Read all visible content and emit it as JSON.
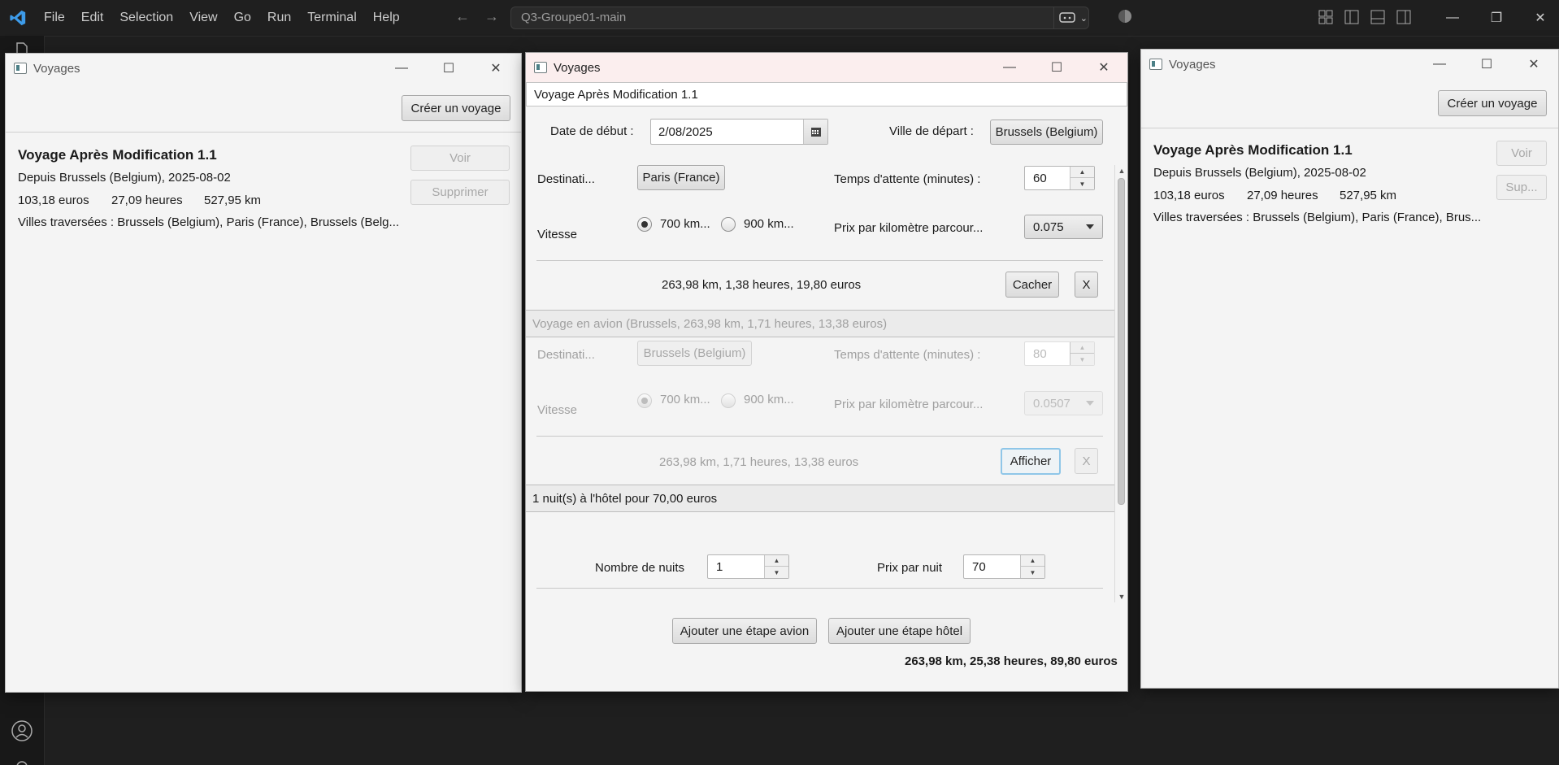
{
  "vscode": {
    "menu": [
      "File",
      "Edit",
      "Selection",
      "View",
      "Go",
      "Run",
      "Terminal",
      "Help"
    ],
    "search_text": "Q3-Groupe01-main"
  },
  "left_window": {
    "title": "Voyages",
    "create_button": "Créer un voyage",
    "voyage": {
      "name": "Voyage Après Modification 1.1",
      "origin": "Depuis Brussels (Belgium), 2025-08-02",
      "price": "103,18 euros",
      "hours": "27,09 heures",
      "km": "527,95 km",
      "cities": "Villes traversées : Brussels (Belgium), Paris (France), Brussels (Belg..."
    },
    "view_button": "Voir",
    "delete_button": "Supprimer"
  },
  "right_window": {
    "title": "Voyages",
    "create_button": "Créer un voyage",
    "voyage": {
      "name": "Voyage Après Modification 1.1",
      "origin": "Depuis Brussels (Belgium), 2025-08-02",
      "price": "103,18 euros",
      "hours": "27,09 heures",
      "km": "527,95 km",
      "cities": "Villes traversées : Brussels (Belgium), Paris (France), Brus..."
    },
    "view_button": "Voir",
    "delete_button": "Sup..."
  },
  "editor": {
    "title": "Voyages",
    "name_value": "Voyage Après Modification 1.1",
    "start_date_label": "Date de début :",
    "start_date_value": "2/08/2025",
    "departure_city_label": "Ville de départ :",
    "departure_city_value": "Brussels (Belgium)",
    "leg1": {
      "destination_label": "Destinati...",
      "destination_value": "Paris (France)",
      "wait_label": "Temps d'attente (minutes) :",
      "wait_value": "60",
      "speed_label": "Vitesse",
      "speed_opt1": "700 km...",
      "speed_opt2": "900 km...",
      "selected_speed": "700 km...",
      "price_km_label": "Prix par kilomètre parcour...",
      "price_km_value": "0.075",
      "summary": "263,98 km, 1,38 heures, 19,80 euros",
      "toggle_button": "Cacher",
      "remove_button": "X"
    },
    "leg2": {
      "header": "Voyage en avion (Brussels, 263,98 km, 1,71 heures, 13,38 euros)",
      "destination_label": "Destinati...",
      "destination_value": "Brussels (Belgium)",
      "wait_label": "Temps d'attente (minutes) :",
      "wait_value": "80",
      "speed_label": "Vitesse",
      "speed_opt1": "700 km...",
      "speed_opt2": "900 km...",
      "selected_speed": "700 km...",
      "price_km_label": "Prix par kilomètre parcour...",
      "price_km_value": "0.0507",
      "summary": "263,98 km, 1,71 heures, 13,38 euros",
      "toggle_button": "Afficher",
      "remove_button": "X"
    },
    "hotel": {
      "header": "1 nuit(s) à l'hôtel pour 70,00 euros",
      "nights_label": "Nombre de nuits",
      "nights_value": "1",
      "price_label": "Prix par nuit",
      "price_value": "70"
    },
    "add_plane_button": "Ajouter une étape avion",
    "add_hotel_button": "Ajouter une étape hôtel",
    "total": "263,98 km, 25,38 heures, 89,80 euros"
  }
}
